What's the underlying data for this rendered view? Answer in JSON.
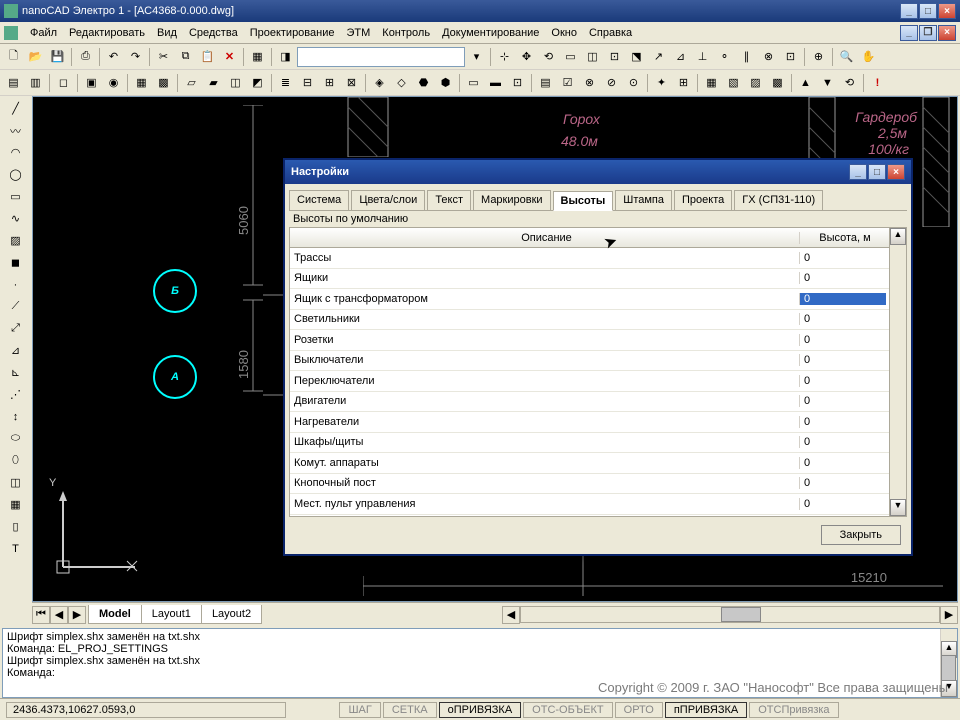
{
  "window": {
    "title": "nanoCAD Электро 1 - [АС4368-0.000.dwg]"
  },
  "menu": [
    "Файл",
    "Редактировать",
    "Вид",
    "Средства",
    "Проектирование",
    "ЭТМ",
    "Контроль",
    "Документирование",
    "Окно",
    "Справка"
  ],
  "canvas": {
    "dim1": "5060",
    "dim2": "1580",
    "dim3": "15210",
    "markA": "А",
    "markB": "Б",
    "axisY": "Y",
    "gar": "Гардероб",
    "garh": "2,5м",
    "gor": "Горох",
    "gorh": "48.0м",
    "rate": "100/кг"
  },
  "viewtabs": [
    "Model",
    "Layout1",
    "Layout2"
  ],
  "cmdlog": "Шрифт simplex.shx заменён на txt.shx\nКоманда: EL_PROJ_SETTINGS\nШрифт simplex.shx заменён на txt.shx\nКоманда:",
  "status": {
    "coords": "2436.4373,10627.0593,0",
    "cells": [
      "ШАГ",
      "СЕТКА",
      "оПРИВЯЗКА",
      "ОТС-ОБЪЕКТ",
      "ОРТО",
      "пПРИВЯЗКА",
      "ОТСПривязка"
    ]
  },
  "copyright": "Copyright © 2009 г. ЗАО \"Нанософт\" Все права защищены",
  "dialog": {
    "title": "Настройки",
    "tabs": [
      "Система",
      "Цвета/слои",
      "Текст",
      "Маркировки",
      "Высоты",
      "Штампа",
      "Проекта",
      "ГХ (СП31-110)"
    ],
    "active_tab": 4,
    "group": "Высоты по умолчанию",
    "col1": "Описание",
    "col2": "Высота, м",
    "rows": [
      {
        "d": "Трассы",
        "v": "0"
      },
      {
        "d": "Ящики",
        "v": "0"
      },
      {
        "d": "Ящик с трансформатором",
        "v": "0"
      },
      {
        "d": "Светильники",
        "v": "0"
      },
      {
        "d": "Розетки",
        "v": "0"
      },
      {
        "d": "Выключатели",
        "v": "0"
      },
      {
        "d": "Переключатели",
        "v": "0"
      },
      {
        "d": "Двигатели",
        "v": "0"
      },
      {
        "d": "Нагреватели",
        "v": "0"
      },
      {
        "d": "Шкафы/щиты",
        "v": "0"
      },
      {
        "d": "Комут. аппараты",
        "v": "0"
      },
      {
        "d": "Кнопочный пост",
        "v": "0"
      },
      {
        "d": "Мест. пульт управления",
        "v": "0"
      }
    ],
    "selected_row": 2,
    "close_btn": "Закрыть"
  }
}
